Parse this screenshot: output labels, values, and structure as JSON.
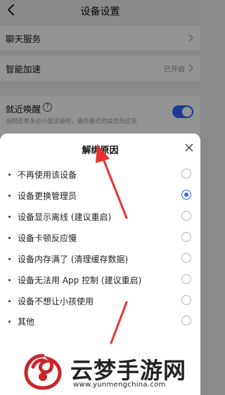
{
  "header": {
    "title": "设备设置"
  },
  "settings": {
    "chat_service": {
      "label": "聊天服务"
    },
    "smart_speedup": {
      "label": "智能加速",
      "value": "已开启"
    },
    "nearby_wake": {
      "label": "就近唤醒",
      "description": "当附近有多台小度设备时，离你最近的会优先应答",
      "enabled": true
    }
  },
  "sheet": {
    "title": "解绑原因",
    "options": [
      {
        "label": "不再使用该设备",
        "selected": false
      },
      {
        "label": "设备更换管理员",
        "selected": true
      },
      {
        "label": "设备显示离线 (建议重启)",
        "selected": false
      },
      {
        "label": "设备卡顿反应慢",
        "selected": false
      },
      {
        "label": "设备内存满了 (清理缓存数据)",
        "selected": false
      },
      {
        "label": "设备无法用 App 控制 (建议重启)",
        "selected": false
      },
      {
        "label": "设备不想让小孩使用",
        "selected": false
      },
      {
        "label": "其他",
        "selected": false
      }
    ]
  },
  "watermark": {
    "brand": "云梦手游网",
    "url": "www.yunmengchina.com"
  },
  "colors": {
    "accent": "#3465ff",
    "annotation_arrow": "#e8322e",
    "watermark_logo": "#c8262b"
  },
  "icons": {
    "back": "chevron-left-icon",
    "row_arrow": "chevron-right-icon",
    "help": "question-circle-icon",
    "close": "close-icon"
  }
}
